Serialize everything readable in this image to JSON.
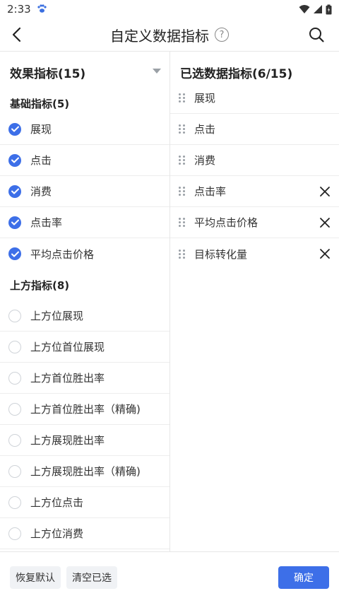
{
  "status_bar": {
    "time": "2:33"
  },
  "header": {
    "title": "自定义数据指标",
    "help_glyph": "?"
  },
  "left_panel": {
    "title": "效果指标(15)",
    "groups": [
      {
        "title": "基础指标(5)",
        "items": [
          "展现",
          "点击",
          "消费",
          "点击率",
          "平均点击价格"
        ]
      },
      {
        "title": "上方指标(8)",
        "items": [
          "上方位展现",
          "上方位首位展现",
          "上方首位胜出率",
          "上方首位胜出率（精确)",
          "上方展现胜出率",
          "上方展现胜出率（精确)",
          "上方位点击",
          "上方位消费"
        ]
      }
    ]
  },
  "right_panel": {
    "title": "已选数据指标(6/15)",
    "items": [
      {
        "label": "展现",
        "removable": false
      },
      {
        "label": "点击",
        "removable": false
      },
      {
        "label": "消费",
        "removable": false
      },
      {
        "label": "点击率",
        "removable": true
      },
      {
        "label": "平均点击价格",
        "removable": true
      },
      {
        "label": "目标转化量",
        "removable": true
      }
    ]
  },
  "footer": {
    "restore_default": "恢复默认",
    "clear_selected": "清空已选",
    "confirm": "确定"
  },
  "colors": {
    "accent": "#3d6fe8"
  }
}
